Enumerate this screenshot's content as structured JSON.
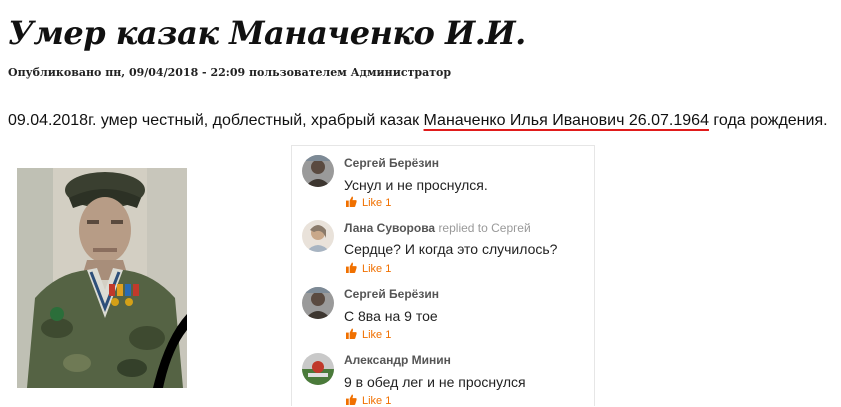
{
  "article": {
    "title": "Умер казак Маначенко И.И.",
    "meta_prefix": "Опубликовано пн, 09/04/2018 - 22:09 пользователем ",
    "meta_author": "Администратор",
    "lead_before": "09.04.2018г. умер честный, доблестный, храбрый казак ",
    "lead_highlight": "Маначенко Илья Иванович 26.07.1964",
    "lead_after": " года рождения."
  },
  "comments": [
    {
      "author": "Сергей Берёзин",
      "reply_to": "",
      "text": "Уснул и не проснулся.",
      "like": "Like 1"
    },
    {
      "author": "Лана Суворова",
      "reply_to": "replied to Сергей",
      "text": "Сердце? И когда это случилось?",
      "like": "Like 1"
    },
    {
      "author": "Сергей Берёзин",
      "reply_to": "",
      "text": "С 8ва на 9 тое",
      "like": "Like 1"
    },
    {
      "author": "Александр Минин",
      "reply_to": "",
      "text": "9 в обед лег и не проснулся",
      "like": "Like 1"
    }
  ],
  "colors": {
    "underline": "#e01b1b",
    "like": "#f07000",
    "mourning_ribbon": "#000000"
  },
  "icons": {
    "like": "thumbs-up-icon",
    "photo": "portrait-photo",
    "ribbon": "mourning-ribbon-icon"
  }
}
